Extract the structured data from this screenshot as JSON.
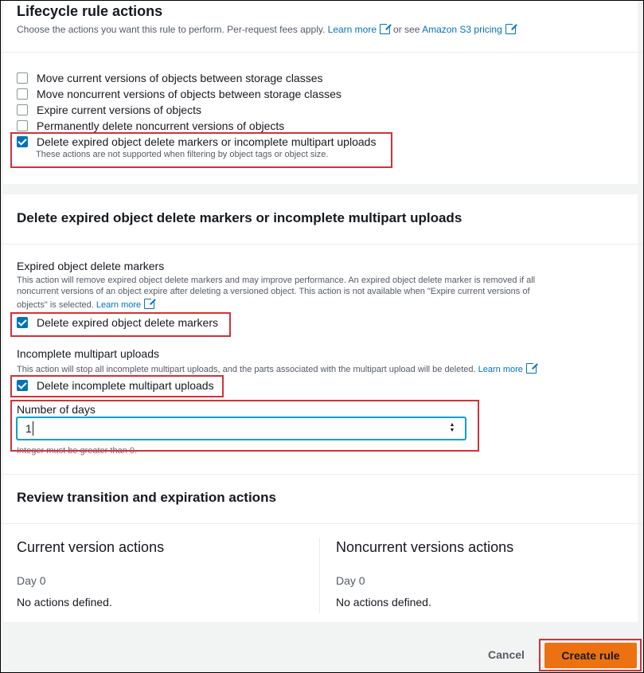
{
  "lifecycle": {
    "title": "Lifecycle rule actions",
    "desc_prefix": "Choose the actions you want this rule to perform. Per-request fees apply.",
    "learn_more": "Learn more",
    "or_see": "or see",
    "pricing_link": "Amazon S3 pricing",
    "options": [
      {
        "label": "Move current versions of objects between storage classes",
        "checked": false
      },
      {
        "label": "Move noncurrent versions of objects between storage classes",
        "checked": false
      },
      {
        "label": "Expire current versions of objects",
        "checked": false
      },
      {
        "label": "Permanently delete noncurrent versions of objects",
        "checked": false
      },
      {
        "label": "Delete expired object delete markers or incomplete multipart uploads",
        "checked": true
      }
    ],
    "option_note": "These actions are not supported when filtering by object tags or object size."
  },
  "delete_section": {
    "title": "Delete expired object delete markers or incomplete multipart uploads",
    "markers": {
      "heading": "Expired object delete markers",
      "desc_line1": "This action will remove expired object delete markers and may improve performance. An expired object delete marker is removed if all",
      "desc_line2": "noncurrent versions of an object expire after deleting a versioned object. This action is not available when \"Expire current versions of",
      "desc_line3": "objects\" is selected.",
      "learn_more": "Learn more",
      "checkbox_label": "Delete expired object delete markers"
    },
    "multipart": {
      "heading": "Incomplete multipart uploads",
      "desc": "This action will stop all incomplete multipart uploads, and the parts associated with the multipart upload will be deleted.",
      "learn_more": "Learn more",
      "checkbox_label": "Delete incomplete multipart uploads"
    },
    "days": {
      "label": "Number of days",
      "value": "1",
      "hint": "Integer must be greater than 0."
    }
  },
  "review": {
    "title": "Review transition and expiration actions",
    "current": {
      "heading": "Current version actions",
      "day": "Day 0",
      "text": "No actions defined."
    },
    "noncurrent": {
      "heading": "Noncurrent versions actions",
      "day": "Day 0",
      "text": "No actions defined."
    }
  },
  "footer": {
    "cancel": "Cancel",
    "create": "Create rule"
  },
  "colors": {
    "accent": "#0073bb",
    "highlight": "#d13239",
    "primary_button": "#ec7211"
  }
}
